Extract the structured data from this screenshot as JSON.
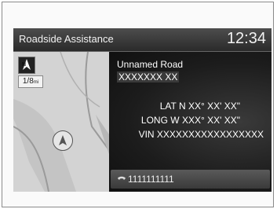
{
  "header": {
    "title": "Roadside Assistance",
    "clock": "12:34"
  },
  "map": {
    "compass_icon": "north-up-icon",
    "scale_label": "1/8",
    "scale_unit": "mi",
    "vehicle_icon": "vehicle-position-icon"
  },
  "location": {
    "road_name": "Unnamed Road",
    "road_detail": "XXXXXXX XX",
    "lat_label": "LAT",
    "lat_value": "N XX° XX' XX\"",
    "long_label": "LONG",
    "long_value": "W XXX° XX' XX\"",
    "vin_label": "VIN",
    "vin_value": "XXXXXXXXXXXXXXXXX"
  },
  "phone": {
    "icon": "phone-handset-icon",
    "number": "1111111111"
  }
}
